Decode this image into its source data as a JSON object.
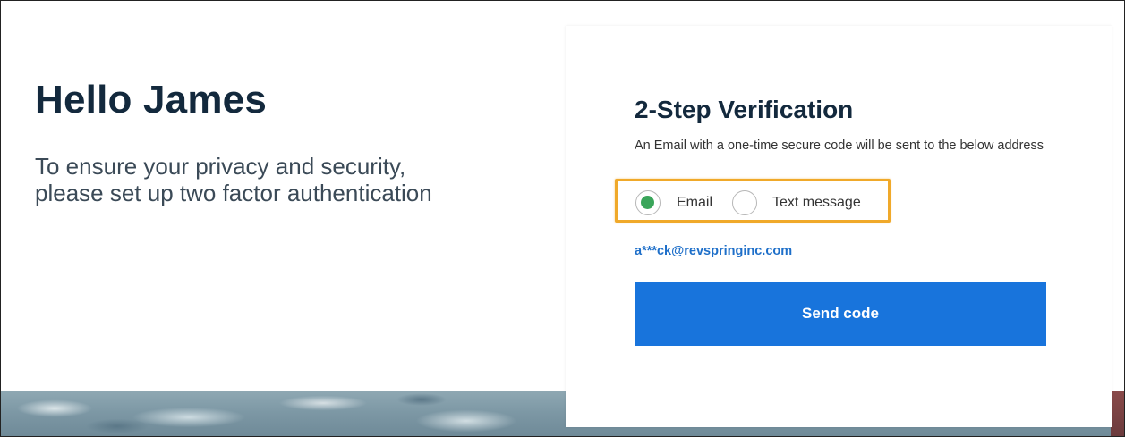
{
  "greeting": {
    "title": "Hello James",
    "message": "To ensure your privacy and security, please set up two factor authentication"
  },
  "verification": {
    "title": "2-Step Verification",
    "description": "An Email with a one-time secure code will be sent to the below address",
    "options": [
      {
        "label": "Email",
        "selected": true
      },
      {
        "label": "Text message",
        "selected": false
      }
    ],
    "address": "a***ck@revspringinc.com",
    "send_label": "Send code"
  },
  "colors": {
    "heading": "#13293d",
    "accent_blue": "#1874dc",
    "link_blue": "#1e6fc9",
    "radio_selected": "#3aa55a",
    "highlight": "#f0a92a"
  }
}
